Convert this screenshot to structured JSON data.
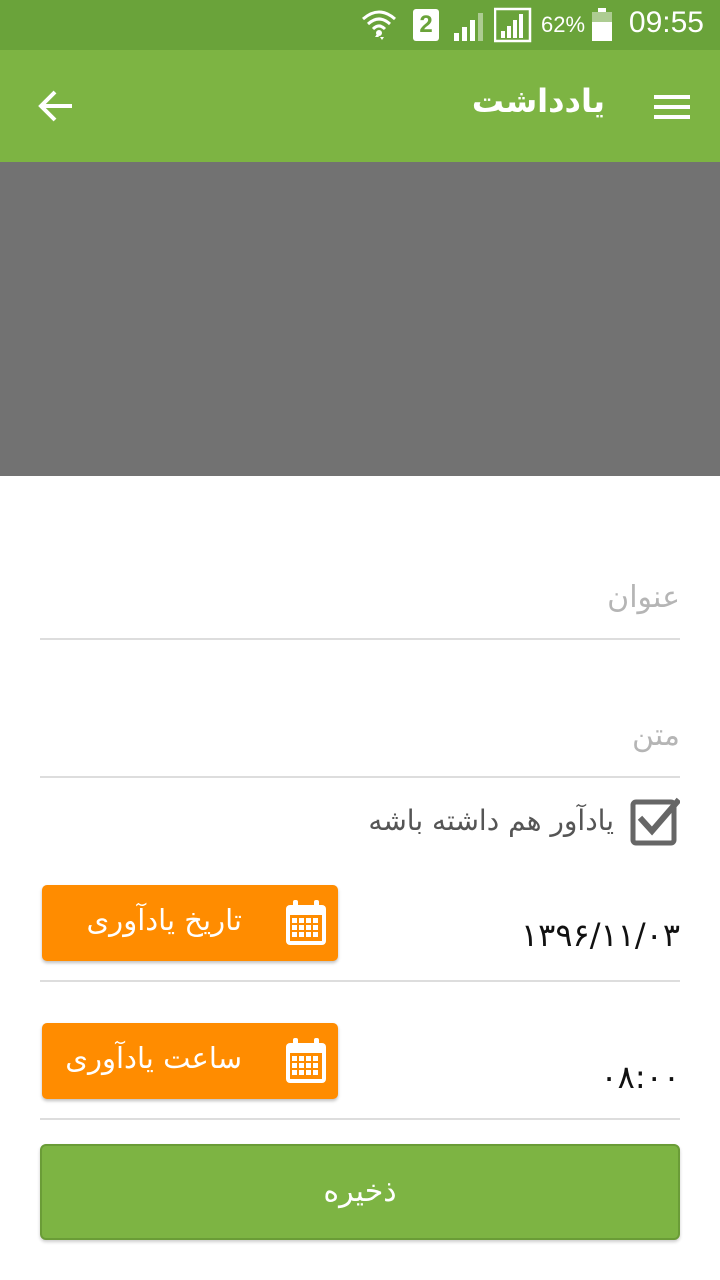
{
  "status_bar": {
    "time": "09:55",
    "battery_percent": "62%",
    "sim_badge": "2",
    "icons": [
      "wifi-icon",
      "sim-badge-icon",
      "signal-1-icon",
      "signal-2-icon",
      "battery-icon"
    ]
  },
  "app_bar": {
    "title": "یادداشت",
    "menu_icon": "hamburger-menu-icon",
    "back_icon": "arrow-left-icon",
    "color": "#7db443"
  },
  "media": {
    "background": "#727272"
  },
  "form": {
    "title_placeholder": "عنوان",
    "body_placeholder": "متن",
    "reminder_checkbox_label": "یادآور هم داشته باشه",
    "reminder_checked": true,
    "date_button_label": "تاریخ یادآوری",
    "date_value": "۱۳۹۶/۱۱/۰۳",
    "time_button_label": "ساعت یادآوری",
    "time_value": "۰۸:۰۰",
    "save_label": "ذخیره",
    "accent_orange": "#ff8c00"
  }
}
